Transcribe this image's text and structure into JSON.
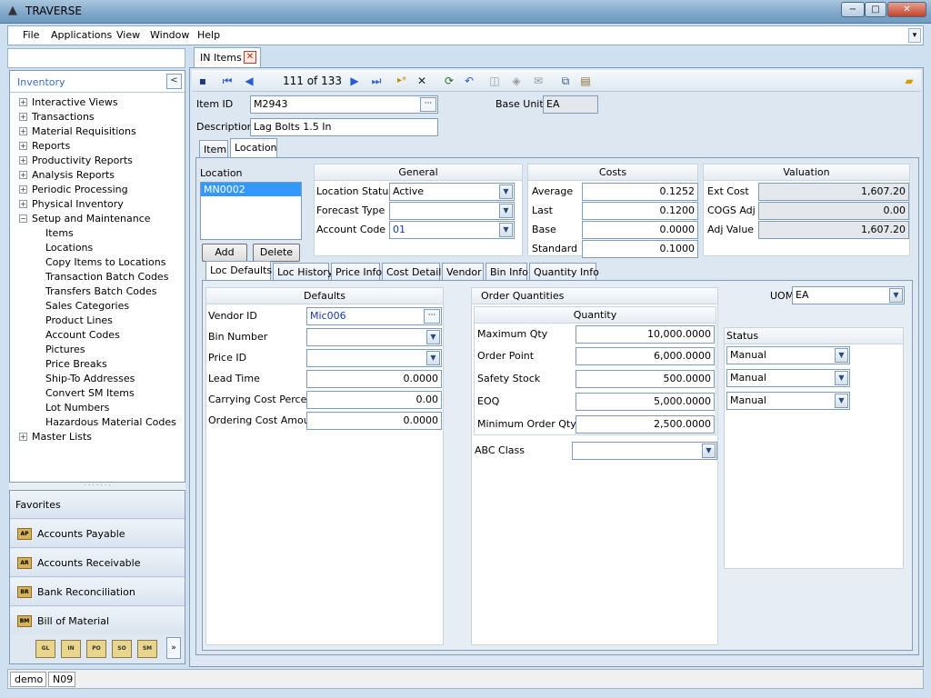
{
  "window": {
    "title": "TRAVERSE",
    "minimize": "−",
    "maximize": "□",
    "close": "✕"
  },
  "menu": [
    "File",
    "Applications",
    "View",
    "Window",
    "Help"
  ],
  "sidebar": {
    "title": "Inventory",
    "collapse_icon": "chevron-left-icon",
    "tree": [
      {
        "label": "Interactive Views",
        "expander": "+"
      },
      {
        "label": "Transactions",
        "expander": "+"
      },
      {
        "label": "Material Requisitions",
        "expander": "+"
      },
      {
        "label": "Reports",
        "expander": "+"
      },
      {
        "label": "Productivity Reports",
        "expander": "+"
      },
      {
        "label": "Analysis Reports",
        "expander": "+"
      },
      {
        "label": "Periodic Processing",
        "expander": "+"
      },
      {
        "label": "Physical Inventory",
        "expander": "+"
      },
      {
        "label": "Setup and Maintenance",
        "expander": "−"
      },
      {
        "label": "Items"
      },
      {
        "label": "Locations"
      },
      {
        "label": "Copy Items to Locations"
      },
      {
        "label": "Transaction Batch Codes"
      },
      {
        "label": "Transfers Batch Codes"
      },
      {
        "label": "Sales Categories"
      },
      {
        "label": "Product Lines"
      },
      {
        "label": "Account Codes"
      },
      {
        "label": "Pictures"
      },
      {
        "label": "Price Breaks"
      },
      {
        "label": "Ship-To Addresses"
      },
      {
        "label": "Convert SM Items"
      },
      {
        "label": "Lot Numbers"
      },
      {
        "label": "Hazardous Material Codes"
      },
      {
        "label": "Master Lists",
        "expander": "+"
      }
    ],
    "favorites": [
      {
        "label": "Favorites"
      },
      {
        "label": "Accounts Payable",
        "icon": "AP"
      },
      {
        "label": "Accounts Receivable",
        "icon": "AR"
      },
      {
        "label": "Bank Reconciliation",
        "icon": "BR"
      },
      {
        "label": "Bill of Material",
        "icon": "BM"
      }
    ],
    "modules": [
      "GL",
      "IN",
      "PO",
      "SO",
      "SM"
    ],
    "more": "»"
  },
  "status": {
    "user": "demo",
    "company": "N09"
  },
  "document": {
    "tab_label": "IN Items",
    "close": "✕",
    "record_position": "111 of 133",
    "toolbar_glyphs": {
      "first": "⏮",
      "prev": "◀",
      "next": "▶",
      "last": "⏭",
      "new": "▸*",
      "delete": "✕",
      "refresh": "⟳",
      "undo": "↶"
    },
    "item_id_label": "Item ID",
    "item_id": "M2943",
    "description_label": "Description",
    "description": "Lag Bolts  1.5 In",
    "base_unit_label": "Base Unit",
    "base_unit": "EA",
    "tabs": [
      "Item",
      "Location"
    ],
    "location": {
      "list_label": "Location",
      "selected": "MN0002",
      "add": "Add",
      "delete": "Delete"
    },
    "general": {
      "title": "General",
      "location_status_label": "Location Status",
      "location_status": "Active",
      "forecast_type_label": "Forecast Type",
      "forecast_type": "",
      "account_code_label": "Account Code",
      "account_code": "01"
    },
    "costs": {
      "title": "Costs",
      "rows": [
        {
          "label": "Average",
          "value": "0.1252"
        },
        {
          "label": "Last",
          "value": "0.1200"
        },
        {
          "label": "Base",
          "value": "0.0000"
        },
        {
          "label": "Standard",
          "value": "0.1000"
        }
      ]
    },
    "valuation": {
      "title": "Valuation",
      "rows": [
        {
          "label": "Ext Cost",
          "value": "1,607.20"
        },
        {
          "label": "COGS Adj",
          "value": "0.00"
        },
        {
          "label": "Adj Value",
          "value": "1,607.20"
        }
      ]
    },
    "subtabs": [
      "Loc Defaults",
      "Loc History",
      "Price Info",
      "Cost Detail",
      "Vendor",
      "Bin Info",
      "Quantity Info"
    ],
    "defaults": {
      "title": "Defaults",
      "vendor_id_label": "Vendor ID",
      "vendor_id": "Mic006",
      "bin_number_label": "Bin Number",
      "bin_number": "",
      "price_id_label": "Price ID",
      "price_id": "",
      "lead_time_label": "Lead Time",
      "lead_time": "0.0000",
      "carrying_cost_label": "Carrying Cost Percent",
      "carrying_cost": "0.00",
      "ordering_cost_label": "Ordering Cost Amount",
      "ordering_cost": "0.0000"
    },
    "order_quantities": {
      "title": "Order Quantities",
      "quantity_header": "Quantity",
      "rows": [
        {
          "label": "Maximum Qty",
          "value": "10,000.0000"
        },
        {
          "label": "Order Point",
          "value": "6,000.0000"
        },
        {
          "label": "Safety Stock",
          "value": "500.0000"
        },
        {
          "label": "EOQ",
          "value": "5,000.0000"
        },
        {
          "label": "Minimum Order Qty",
          "value": "2,500.0000"
        }
      ],
      "abc_class_label": "ABC Class",
      "abc_class": ""
    },
    "uom_label": "UOM",
    "uom": "EA",
    "status": {
      "title": "Status",
      "values": [
        "Manual",
        "Manual",
        "Manual"
      ]
    }
  }
}
